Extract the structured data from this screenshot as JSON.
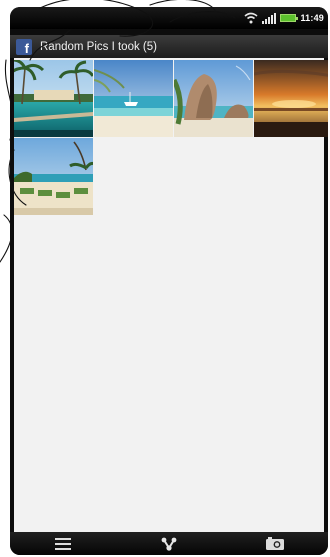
{
  "status_bar": {
    "time": "11:49",
    "icons": [
      "wifi-icon",
      "signal-icon",
      "battery-icon"
    ],
    "battery_color": "#5cc12e"
  },
  "album": {
    "icon": "facebook-icon",
    "icon_letter": "f",
    "title": "Random Pics I took (5)",
    "brand_color": "#3b5998"
  },
  "photos": [
    {
      "name": "photo-resort-pool"
    },
    {
      "name": "photo-beach-boat"
    },
    {
      "name": "photo-rock-coast"
    },
    {
      "name": "photo-sunset"
    },
    {
      "name": "photo-beach-loungers"
    }
  ],
  "bottom_bar": {
    "buttons": [
      "menu-icon",
      "share-icon",
      "camera-icon"
    ]
  }
}
